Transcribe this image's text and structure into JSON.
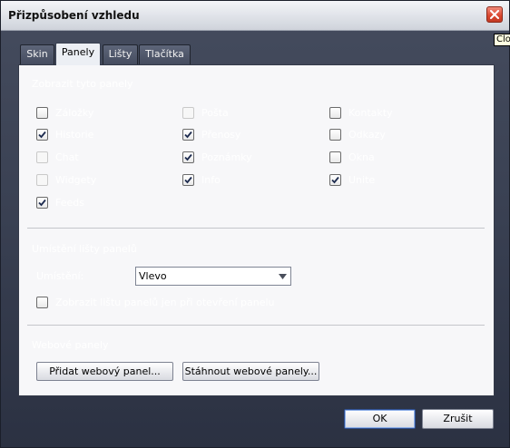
{
  "window": {
    "title": "Přizpůsobení vzhledu",
    "close_tooltip": "Close"
  },
  "tabs": [
    {
      "label": "Skin",
      "active": false
    },
    {
      "label": "Panely",
      "active": true
    },
    {
      "label": "Lišty",
      "active": false
    },
    {
      "label": "Tlačítka",
      "active": false
    }
  ],
  "panels_tab": {
    "section1_heading": "Zobrazit tyto panely",
    "checkboxes": [
      {
        "label": "Záložky",
        "checked": false,
        "enabled": true
      },
      {
        "label": "Pošta",
        "checked": false,
        "enabled": false
      },
      {
        "label": "Kontakty",
        "checked": false,
        "enabled": true
      },
      {
        "label": "Historie",
        "checked": true,
        "enabled": true
      },
      {
        "label": "Přenosy",
        "checked": true,
        "enabled": true
      },
      {
        "label": "Odkazy",
        "checked": false,
        "enabled": true
      },
      {
        "label": "Chat",
        "checked": false,
        "enabled": false
      },
      {
        "label": "Poznámky",
        "checked": true,
        "enabled": true
      },
      {
        "label": "Okna",
        "checked": false,
        "enabled": true
      },
      {
        "label": "Widgety",
        "checked": false,
        "enabled": false
      },
      {
        "label": "Info",
        "checked": true,
        "enabled": true
      },
      {
        "label": "Unite",
        "checked": true,
        "enabled": true
      },
      {
        "label": "Feeds",
        "checked": true,
        "enabled": true
      }
    ],
    "section2_heading": "Umístění lišty panelů",
    "position_label": "Umístění:",
    "position_value": "Vlevo",
    "hide_toggle": {
      "label": "Zobrazit lištu panelů jen při otevření panelu",
      "checked": false
    },
    "section3_heading": "Webové panely",
    "add_web_panel_label": "Přidat webový panel...",
    "download_web_panels_label": "Stáhnout webové panely..."
  },
  "footer": {
    "ok_label": "OK",
    "cancel_label": "Zrušit"
  }
}
